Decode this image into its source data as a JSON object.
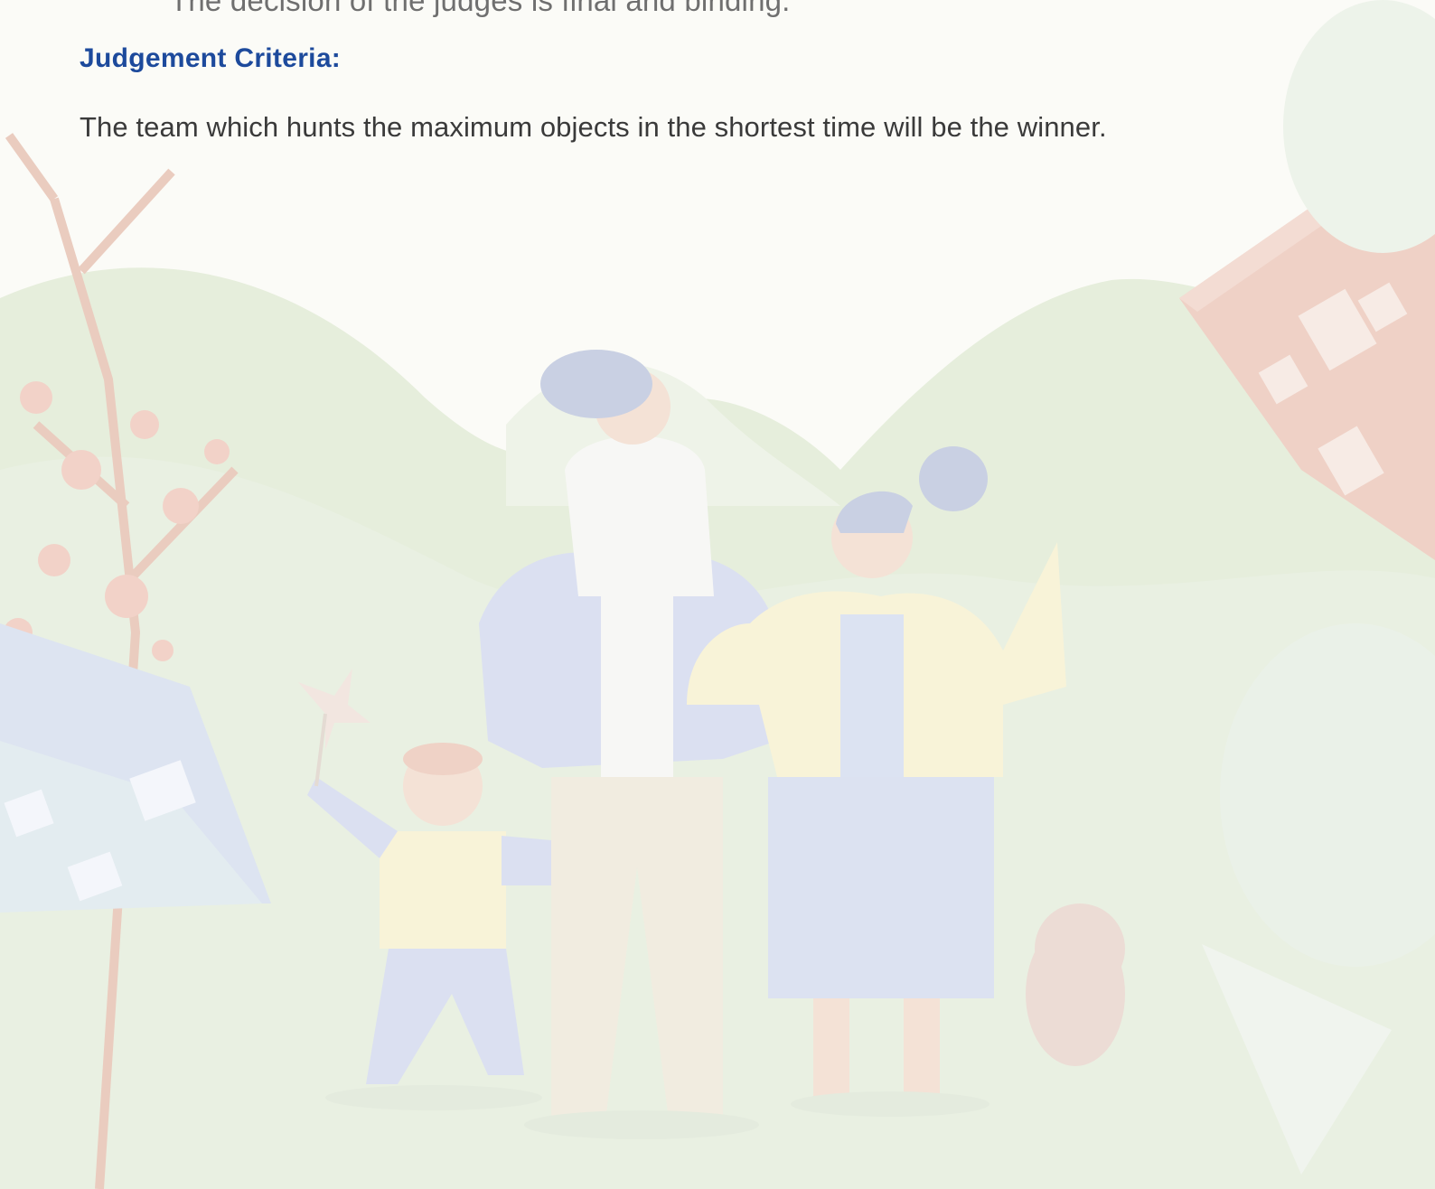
{
  "document": {
    "cut_off_line": "The decision of the judges is final and binding.",
    "section_heading": "Judgement Criteria:",
    "section_body": "The team which hunts the maximum objects in the shortest time will be the winner."
  },
  "illustration": {
    "name": "family-outing-watermark",
    "colors": {
      "paper": "#fbfbf7",
      "hills": "#e2ecd8",
      "house_red": "#ecc7bc",
      "house_blue": "#dde3f0",
      "jacket_blue": "#d5dcef",
      "cardigan_yellow": "#f8f2cf",
      "skin": "#f3dccd",
      "hair": "#b9c2dc"
    }
  }
}
